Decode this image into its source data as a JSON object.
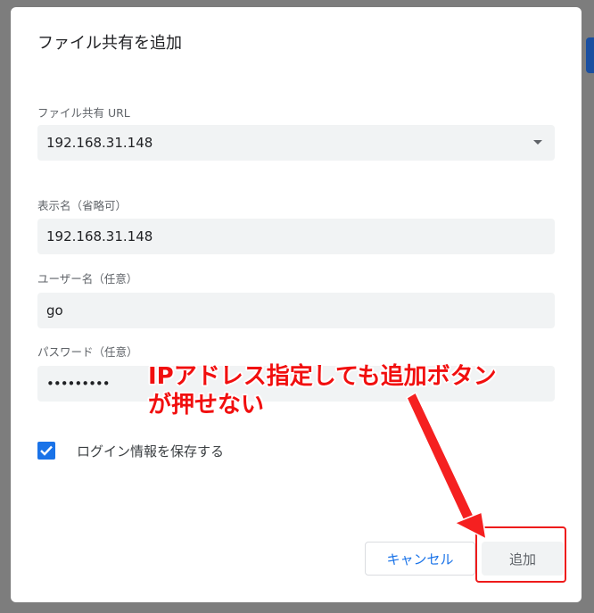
{
  "dialog": {
    "title": "ファイル共有を追加",
    "url_field": {
      "label": "ファイル共有 URL",
      "value": "192.168.31.148"
    },
    "display_name_field": {
      "label": "表示名（省略可）",
      "value": "192.168.31.148"
    },
    "username_field": {
      "label": "ユーザー名（任意）",
      "value": "go"
    },
    "password_field": {
      "label": "パスワード（任意）",
      "value": "•••••••••"
    },
    "remember_checkbox": {
      "label": "ログイン情報を保存する",
      "checked": true
    },
    "buttons": {
      "cancel": "キャンセル",
      "add": "追加"
    }
  },
  "annotation": {
    "line1": "IPアドレス指定しても追加ボタン",
    "line2": "が押せない",
    "color": "#f10f0f"
  },
  "colors": {
    "accent": "#1a73e8",
    "field_bg": "#f1f3f4",
    "annotation_red": "#ee1b1b"
  }
}
